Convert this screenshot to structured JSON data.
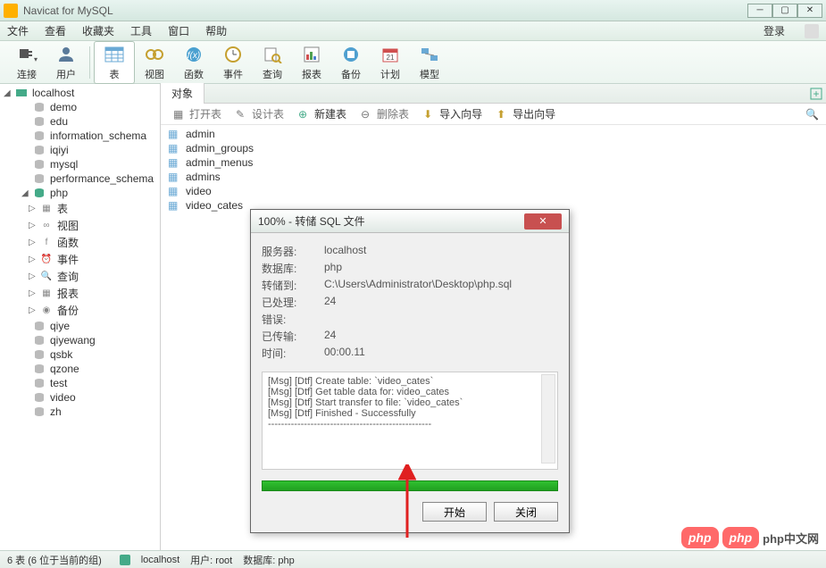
{
  "app": {
    "title": "Navicat for MySQL"
  },
  "menu": {
    "file": "文件",
    "view": "查看",
    "favorites": "收藏夹",
    "tools": "工具",
    "window": "窗口",
    "help": "帮助",
    "login": "登录"
  },
  "toolbar": {
    "connection": "连接",
    "user": "用户",
    "table": "表",
    "view": "视图",
    "function": "函数",
    "event": "事件",
    "query": "查询",
    "report": "报表",
    "backup": "备份",
    "schedule": "计划",
    "model": "模型"
  },
  "tree": {
    "localhost": "localhost",
    "databases": [
      "demo",
      "edu",
      "information_schema",
      "iqiyi",
      "mysql",
      "performance_schema"
    ],
    "current_db": "php",
    "php_children": [
      {
        "label": "表",
        "icon": "table"
      },
      {
        "label": "视图",
        "icon": "view"
      },
      {
        "label": "函数",
        "icon": "function"
      },
      {
        "label": "事件",
        "icon": "event"
      },
      {
        "label": "查询",
        "icon": "query"
      },
      {
        "label": "报表",
        "icon": "report"
      },
      {
        "label": "备份",
        "icon": "backup"
      }
    ],
    "other_dbs": [
      "qiye",
      "qiyewang",
      "qsbk",
      "qzone",
      "test",
      "video",
      "zh"
    ]
  },
  "tabs": {
    "objects": "对象"
  },
  "actions": {
    "open": "打开表",
    "design": "设计表",
    "new": "新建表",
    "delete": "删除表",
    "import": "导入向导",
    "export": "导出向导"
  },
  "tables": [
    "admin",
    "admin_groups",
    "admin_menus",
    "admins",
    "video",
    "video_cates"
  ],
  "dialog": {
    "title": "100% - 转储 SQL 文件",
    "labels": {
      "server": "服务器:",
      "database": "数据库:",
      "saveto": "转储到:",
      "processed": "已处理:",
      "errors": "错误:",
      "transferred": "已传输:",
      "time": "时间:"
    },
    "values": {
      "server": "localhost",
      "database": "php",
      "saveto": "C:\\Users\\Administrator\\Desktop\\php.sql",
      "processed": "24",
      "errors": "",
      "transferred": "24",
      "time": "00:00.11"
    },
    "messages": [
      "[Msg] [Dtf] Create table: `video_cates`",
      "[Msg] [Dtf] Get table data for: video_cates",
      "[Msg] [Dtf] Start transfer to file: `video_cates`",
      "[Msg] [Dtf] Finished - Successfully",
      "--------------------------------------------------"
    ],
    "buttons": {
      "start": "开始",
      "close": "关闭"
    }
  },
  "status": {
    "count": "6 表 (6 位于当前的组)",
    "conn": "localhost",
    "user_label": "用户:",
    "user": "root",
    "db_label": "数据库:",
    "db": "php"
  },
  "watermark": {
    "badge": "php",
    "text": "php中文网"
  }
}
